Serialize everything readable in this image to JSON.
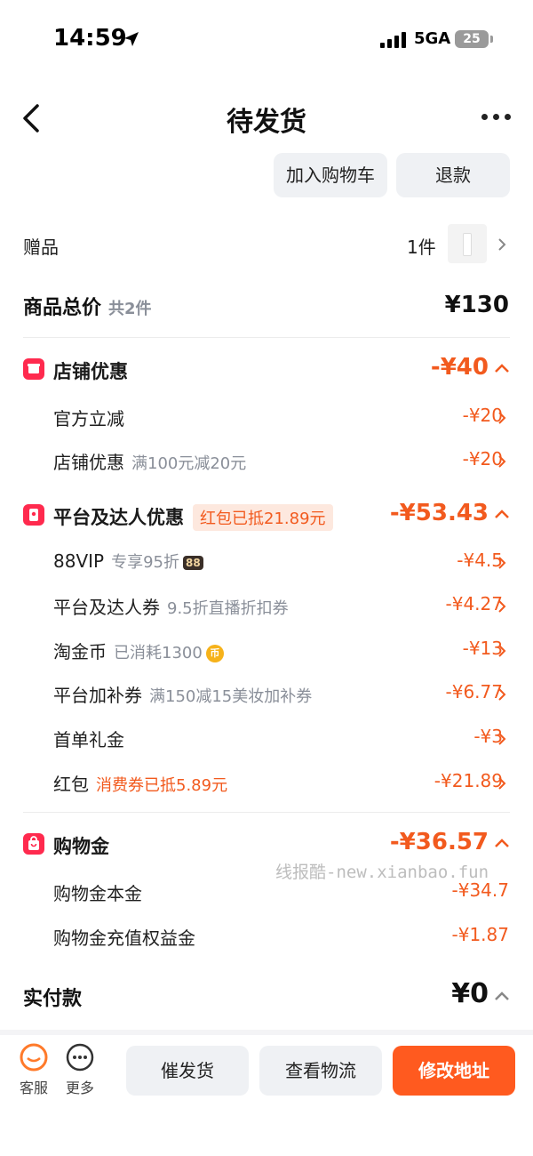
{
  "status_bar": {
    "time": "14:59",
    "network": "5GA",
    "battery": "25"
  },
  "nav": {
    "title": "待发货"
  },
  "actions": {
    "add_to_cart": "加入购物车",
    "refund": "退款"
  },
  "gift": {
    "label": "赠品",
    "count": "1件"
  },
  "total": {
    "label": "商品总价",
    "sub": "共2件",
    "amount": "¥130"
  },
  "store_discount": {
    "title": "店铺优惠",
    "amount": "-¥40",
    "items": [
      {
        "label": "官方立减",
        "sub": "",
        "amount": "-¥20"
      },
      {
        "label": "店铺优惠",
        "sub": "满100元减20元",
        "amount": "-¥20"
      }
    ]
  },
  "platform_discount": {
    "title": "平台及达人优惠",
    "tag": "红包已抵21.89元",
    "amount": "-¥53.43",
    "items": [
      {
        "label": "88VIP",
        "sub": "专享95折",
        "badge": "88",
        "amount": "-¥4.5"
      },
      {
        "label": "平台及达人券",
        "sub": "9.5折直播折扣券",
        "amount": "-¥4.27"
      },
      {
        "label": "淘金币",
        "sub": "已消耗1300",
        "coin": "币",
        "amount": "-¥13"
      },
      {
        "label": "平台加补券",
        "sub": "满150减15美妆加补券",
        "amount": "-¥6.77"
      },
      {
        "label": "首单礼金",
        "sub": "",
        "amount": "-¥3"
      },
      {
        "label": "红包",
        "sub": "消费券已抵5.89元",
        "amount": "-¥21.89"
      }
    ]
  },
  "shopping_money": {
    "title": "购物金",
    "amount": "-¥36.57",
    "items": [
      {
        "label": "购物金本金",
        "amount": "-¥34.7"
      },
      {
        "label": "购物金充值权益金",
        "amount": "-¥1.87"
      }
    ]
  },
  "watermark": "线报酷-new.xianbao.fun",
  "paid": {
    "label": "实付款",
    "amount": "¥0"
  },
  "bottom": {
    "service": "客服",
    "more": "更多",
    "urge": "催发货",
    "logistics": "查看物流",
    "change_address": "修改地址"
  },
  "colors": {
    "accent": "#f25a1e",
    "primary_button": "#ff5a1f",
    "section_icon": "#ff2a4e"
  }
}
